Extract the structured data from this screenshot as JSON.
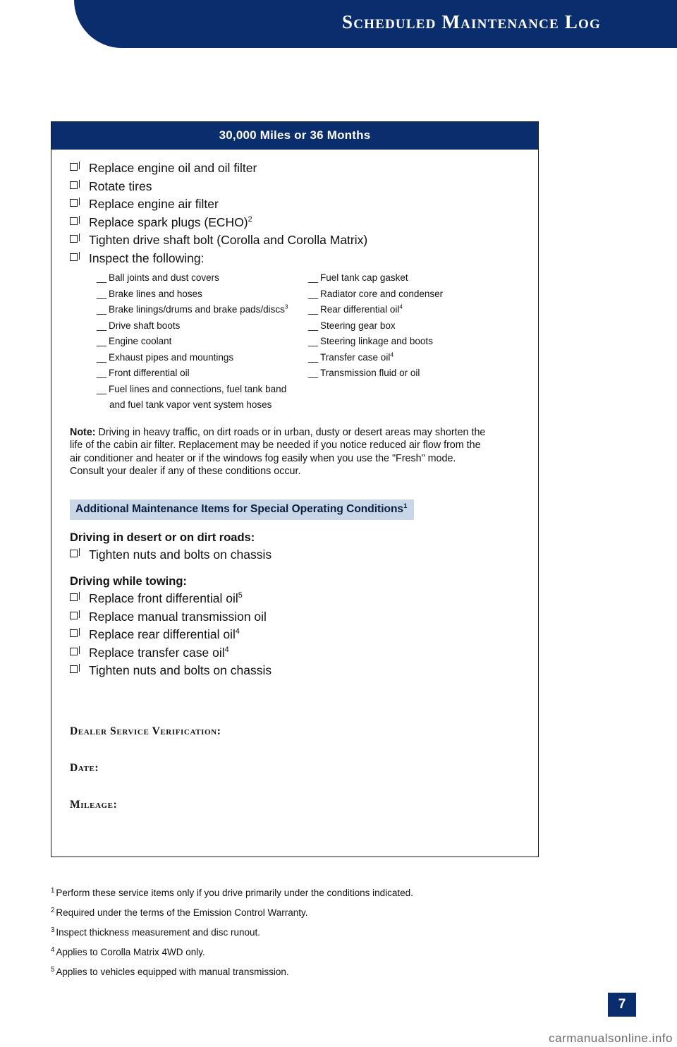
{
  "header": {
    "title": "Scheduled Maintenance Log"
  },
  "card": {
    "title": "30,000 Miles or 36 Months",
    "items": [
      {
        "text": "Replace engine oil and oil filter",
        "sup": ""
      },
      {
        "text": "Rotate tires",
        "sup": ""
      },
      {
        "text": "Replace engine air filter",
        "sup": ""
      },
      {
        "text": "Replace spark plugs (ECHO)",
        "sup": "2"
      },
      {
        "text": "Tighten drive shaft bolt (Corolla and Corolla Matrix)",
        "sup": ""
      },
      {
        "text": "Inspect the following:",
        "sup": ""
      }
    ],
    "inspect_left": [
      {
        "text": "Ball joints and dust covers",
        "sup": "",
        "cont": ""
      },
      {
        "text": "Brake lines and hoses",
        "sup": "",
        "cont": ""
      },
      {
        "text": "Brake linings/drums and brake pads/discs",
        "sup": "3",
        "cont": ""
      },
      {
        "text": "Drive shaft boots",
        "sup": "",
        "cont": ""
      },
      {
        "text": "Engine coolant",
        "sup": "",
        "cont": ""
      },
      {
        "text": "Exhaust pipes and mountings",
        "sup": "",
        "cont": ""
      },
      {
        "text": "Front differential oil",
        "sup": "",
        "cont": ""
      },
      {
        "text": "Fuel lines and connections, fuel tank band",
        "sup": "",
        "cont": "and fuel tank vapor vent system hoses"
      }
    ],
    "inspect_right": [
      {
        "text": "Fuel tank cap gasket",
        "sup": "",
        "cont": ""
      },
      {
        "text": "Radiator core and condenser",
        "sup": "",
        "cont": ""
      },
      {
        "text": "Rear differential oil",
        "sup": "4",
        "cont": ""
      },
      {
        "text": "Steering gear box",
        "sup": "",
        "cont": ""
      },
      {
        "text": "Steering linkage and boots",
        "sup": "",
        "cont": ""
      },
      {
        "text": "Transfer case oil",
        "sup": "4",
        "cont": ""
      },
      {
        "text": "Transmission fluid or oil",
        "sup": "",
        "cont": ""
      }
    ],
    "note_label": "Note:",
    "note_text": " Driving in heavy traffic, on dirt roads or in urban, dusty or desert areas may shorten the life of the cabin air filter. Replacement may be needed if you notice reduced air flow from the air conditioner and heater or if the windows fog easily when you use the \"Fresh\" mode. Consult your dealer if any of these conditions occur.",
    "additional_title": "Additional Maintenance Items for Special Operating Conditions",
    "additional_title_sup": "1",
    "section_desert": {
      "heading": "Driving in desert or on dirt roads:",
      "items": [
        {
          "text": "Tighten nuts and bolts on chassis",
          "sup": ""
        }
      ]
    },
    "section_towing": {
      "heading": "Driving while towing:",
      "items": [
        {
          "text": "Replace front differential oil",
          "sup": "5"
        },
        {
          "text": "Replace manual transmission oil",
          "sup": ""
        },
        {
          "text": "Replace rear differential oil",
          "sup": "4"
        },
        {
          "text": "Replace transfer case oil",
          "sup": "4"
        },
        {
          "text": "Tighten nuts and bolts on chassis",
          "sup": ""
        }
      ]
    },
    "verification": [
      "Dealer Service Verification:",
      "Date:",
      "Mileage:"
    ]
  },
  "footnotes": [
    {
      "marker": "1",
      "text": "Perform these service items only if you drive primarily under the conditions indicated."
    },
    {
      "marker": "2",
      "text": "Required under the terms of the Emission Control Warranty."
    },
    {
      "marker": "3",
      "text": "Inspect thickness measurement and disc runout."
    },
    {
      "marker": "4",
      "text": "Applies to Corolla Matrix 4WD only."
    },
    {
      "marker": "5",
      "text": "Applies to vehicles equipped with manual transmission."
    }
  ],
  "page_number": "7",
  "watermark": "carmanualsonline.info",
  "colors": {
    "navy": "#0a2d6e",
    "subtitle_bar": "#c9d6e8"
  }
}
